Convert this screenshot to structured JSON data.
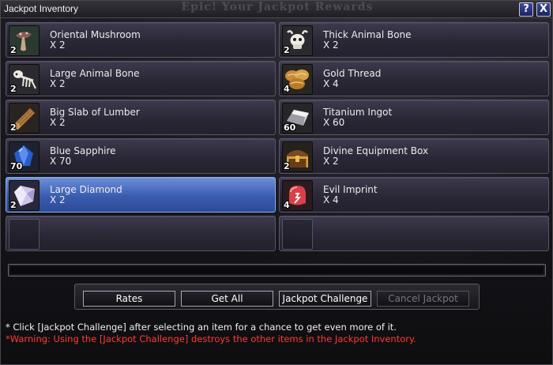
{
  "window": {
    "title": "Jackpot Inventory",
    "background_banner": "Epic! Your Jackpot Rewards",
    "help_label": "?",
    "close_label": "X"
  },
  "items": [
    {
      "name": "Oriental Mushroom",
      "count": "X 2",
      "qty": "2",
      "icon": "mushroom-icon"
    },
    {
      "name": "Thick Animal Bone",
      "count": "X 2",
      "qty": "2",
      "icon": "animal-skull-icon"
    },
    {
      "name": "Large Animal Bone",
      "count": "X 2",
      "qty": "2",
      "icon": "animal-skeleton-icon"
    },
    {
      "name": "Gold Thread",
      "count": "X 4",
      "qty": "4",
      "icon": "gold-thread-spools-icon"
    },
    {
      "name": "Big Slab of Lumber",
      "count": "X 2",
      "qty": "2",
      "icon": "lumber-log-icon"
    },
    {
      "name": "Titanium Ingot",
      "count": "X 60",
      "qty": "60",
      "icon": "ingot-icon"
    },
    {
      "name": "Blue Sapphire",
      "count": "X 70",
      "qty": "70",
      "icon": "sapphire-gem-icon"
    },
    {
      "name": "Divine Equipment Box",
      "count": "X 2",
      "qty": "2",
      "icon": "treasure-chest-icon"
    },
    {
      "name": "Large Diamond",
      "count": "X 2",
      "qty": "2",
      "icon": "diamond-gem-icon",
      "selected": true
    },
    {
      "name": "Evil Imprint",
      "count": "X 4",
      "qty": "4",
      "icon": "evil-imprint-icon"
    }
  ],
  "progress": {
    "value": 0
  },
  "buttons": {
    "rates": "Rates",
    "get_all": "Get All",
    "jackpot_challenge": "Jackpot Challenge",
    "cancel_jackpot": "Cancel Jackpot"
  },
  "notes": {
    "info": "* Click [Jackpot Challenge] after selecting an item for a chance to get even more of it.",
    "warning": "*Warning: Using the [Jackpot Challenge] destroys the other items in the Jackpot Inventory."
  },
  "colors": {
    "selected_slot": "#3a5cb0",
    "warning_text": "#ff3b30",
    "title_button": "#2a338a"
  }
}
